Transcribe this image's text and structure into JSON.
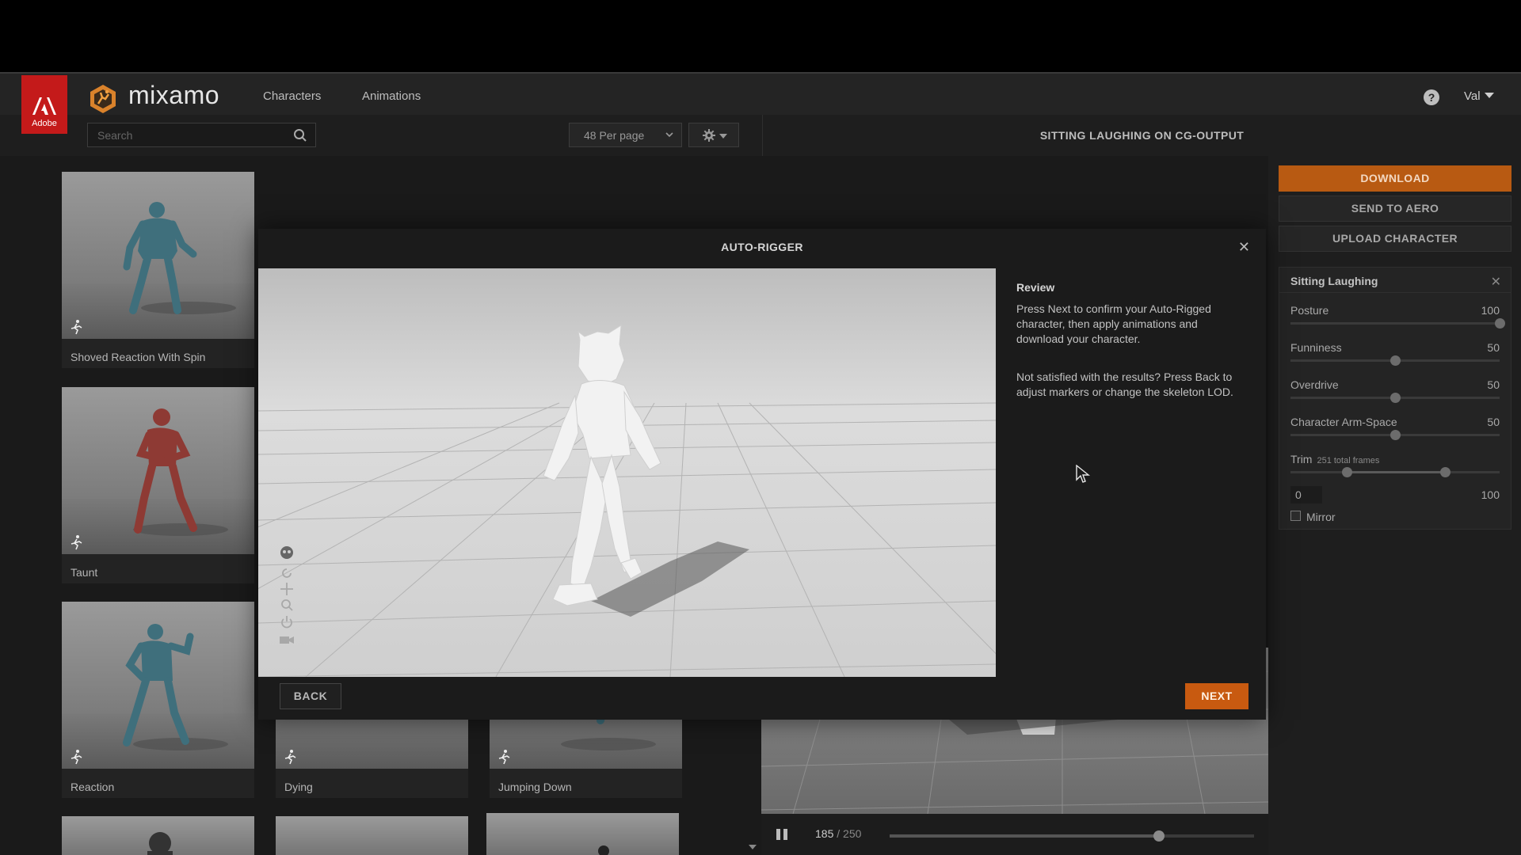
{
  "header": {
    "adobe_text": "Adobe",
    "brand": "mixamo",
    "nav": [
      "Characters",
      "Animations"
    ],
    "user": "Val"
  },
  "toolbar": {
    "search_placeholder": "Search",
    "per_page": "48 Per page",
    "title": "SITTING LAUGHING ON CG-OUTPUT"
  },
  "gallery": {
    "cards": [
      {
        "label": "Shoved Reaction With Spin"
      },
      {
        "label": "Taunt"
      },
      {
        "label": "Reaction"
      },
      {
        "label": "Dying"
      },
      {
        "label": "Jumping Down"
      }
    ]
  },
  "player": {
    "frame": "185",
    "total": "250",
    "progress": 0.74
  },
  "right_panel": {
    "download": "DOWNLOAD",
    "send_to_aero": "SEND TO AERO",
    "upload_character": "UPLOAD CHARACTER",
    "settings_title": "Sitting Laughing",
    "sliders": [
      {
        "label": "Posture",
        "value": "100",
        "level": 1.0
      },
      {
        "label": "Funniness",
        "value": "50",
        "level": 0.5
      },
      {
        "label": "Overdrive",
        "value": "50",
        "level": 0.5
      },
      {
        "label": "Character Arm-Space",
        "value": "50",
        "level": 0.5
      }
    ],
    "trim": {
      "label": "Trim",
      "sub": "251 total frames",
      "start_level": 0.27,
      "end_level": 0.74,
      "start": "0",
      "end": "100"
    },
    "mirror": "Mirror"
  },
  "modal": {
    "title": "AUTO-RIGGER",
    "review_title": "Review",
    "review_p1": "Press Next to confirm your Auto-Rigged character, then apply animations and download your character.",
    "review_p2": "Not satisfied with the results? Press Back to adjust markers or change the skeleton LOD.",
    "back": "BACK",
    "next": "NEXT"
  },
  "colors": {
    "accent": "#c85a10",
    "adobe_red": "#c41a1a",
    "figure_teal": "#3f6f7c",
    "figure_red": "#8e3a34"
  }
}
